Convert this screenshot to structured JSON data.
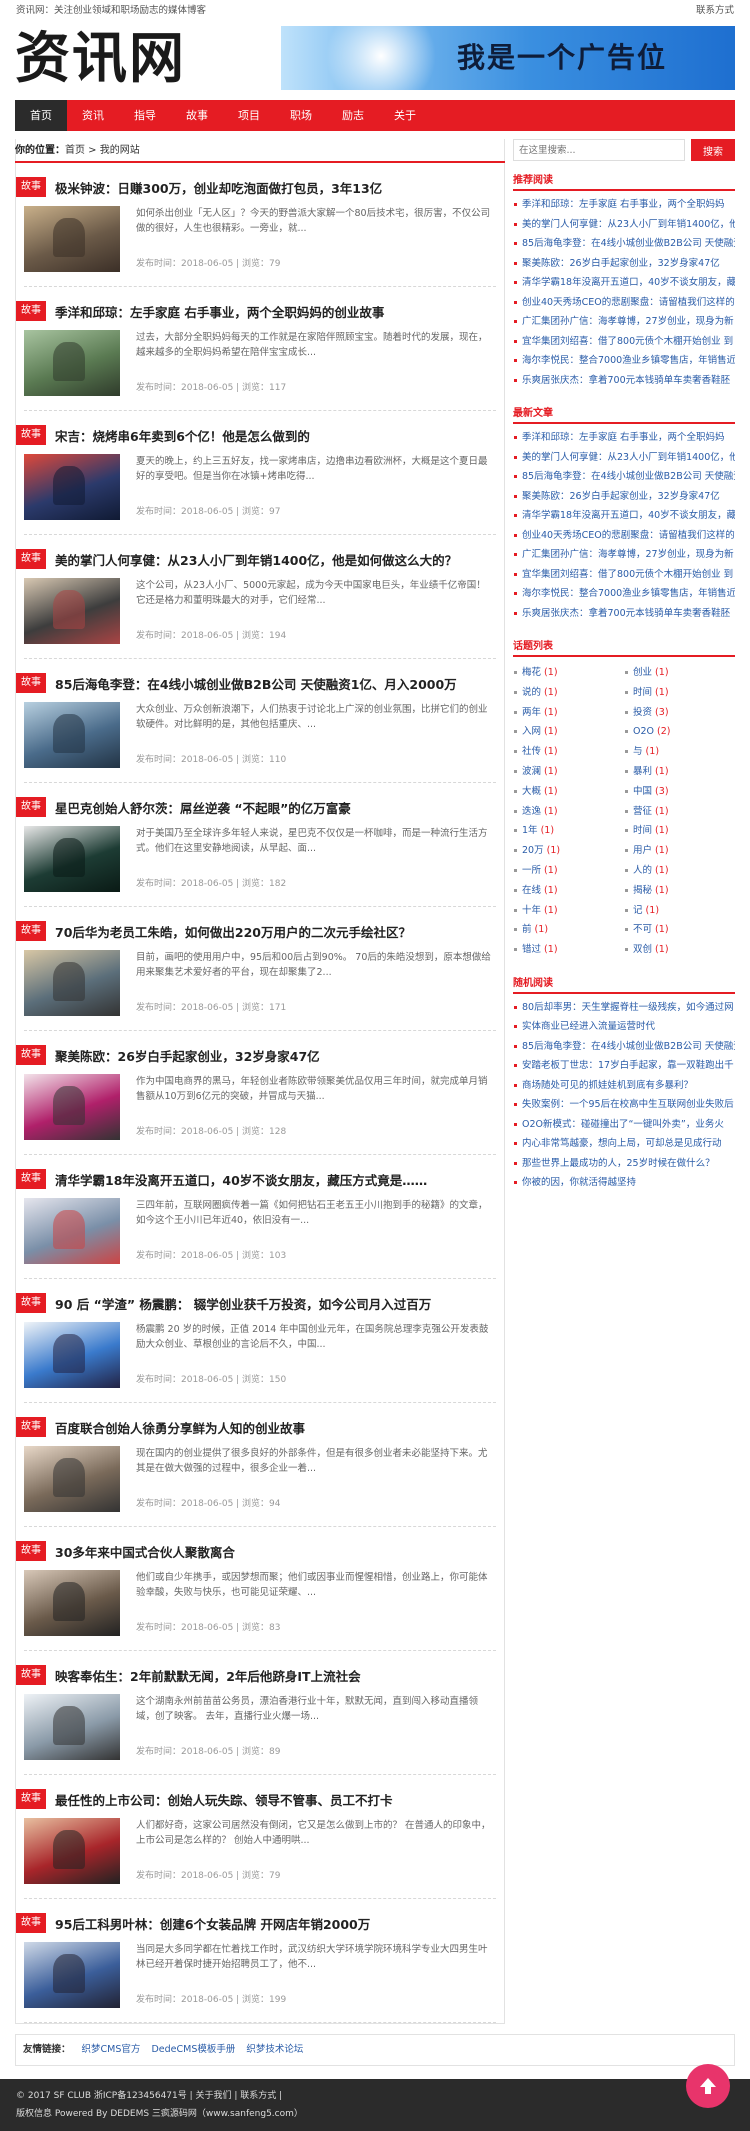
{
  "topbar": {
    "slogan": "资讯网：关注创业领域和职场励志的媒体博客",
    "contact": "联系方式"
  },
  "header": {
    "logo": "资讯网",
    "banner": "我是一个广告位"
  },
  "nav": [
    "首页",
    "资讯",
    "指导",
    "故事",
    "项目",
    "职场",
    "励志",
    "关于"
  ],
  "crumb": {
    "label": "你的位置：",
    "path": "首页 > 我的网站"
  },
  "search": {
    "placeholder": "在这里搜索...",
    "button": "搜索"
  },
  "articles": [
    {
      "tag": "故事",
      "title": "极米钟波：日赚300万，创业却吃泡面做打包员，3年13亿",
      "summary": "如何杀出创业「无人区」？今天的野兽派大家解一个80后技术宅，很厉害，不仅公司做的很好，人生也很精彩。一旁业，就...",
      "meta": "发布时间：2018-06-05 | 浏览：79"
    },
    {
      "tag": "故事",
      "title": "季洋和邱琼：左手家庭 右手事业，两个全职妈妈的创业故事",
      "summary": "过去，大部分全职妈妈每天的工作就是在家陪伴照顾宝宝。随着时代的发展，现在，越来越多的全职妈妈希望在陪伴宝宝成长...",
      "meta": "发布时间：2018-06-05 | 浏览：117"
    },
    {
      "tag": "故事",
      "title": "宋吉：烧烤串6年卖到6个亿！他是怎么做到的",
      "summary": "夏天的晚上，约上三五好友，找一家烤串店，边撸串边看欧洲杯，大概是这个夏日最好的享受吧。但是当你在冰镇+烤串吃得...",
      "meta": "发布时间：2018-06-05 | 浏览：97"
    },
    {
      "tag": "故事",
      "title": "美的掌门人何享健：从23人小厂到年销1400亿，他是如何做这么大的？",
      "summary": "这个公司，从23人小厂、5000元家起，成为今天中国家电巨头，年业绩千亿帝国！ 它还是格力和董明珠最大的对手，它们经常...",
      "meta": "发布时间：2018-06-05 | 浏览：194"
    },
    {
      "tag": "故事",
      "title": "85后海龟李登：在4线小城创业做B2B公司 天使融资1亿、月入2000万",
      "summary": "大众创业、万众创新浪潮下，人们热衷于讨论北上广深的创业氛围，比拼它们的创业软硬件。对比鲜明的是，其他包括重庆、...",
      "meta": "发布时间：2018-06-05 | 浏览：110"
    },
    {
      "tag": "故事",
      "title": "星巴克创始人舒尔茨：屌丝逆袭 “不起眼”的亿万富豪",
      "summary": "对于美国乃至全球许多年轻人来说，星巴克不仅仅是一杯咖啡，而是一种流行生活方式。他们在这里安静地阅读，从早起、面...",
      "meta": "发布时间：2018-06-05 | 浏览：182"
    },
    {
      "tag": "故事",
      "title": "70后华为老员工朱皓，如何做出220万用户的二次元手绘社区？",
      "summary": "目前，画吧的使用用户中，95后和00后占到90%。 70后的朱皓没想到，原本想做给用来聚集艺术爱好者的平台，现在却聚集了2...",
      "meta": "发布时间：2018-06-05 | 浏览：171"
    },
    {
      "tag": "故事",
      "title": "聚美陈欧：26岁白手起家创业，32岁身家47亿",
      "summary": "作为中国电商界的黑马，年轻创业者陈欧带领聚美优品仅用三年时间，就完成单月销售额从10万到6亿元的突破，并冒成与天猫...",
      "meta": "发布时间：2018-06-05 | 浏览：128"
    },
    {
      "tag": "故事",
      "title": "清华学霸18年没离开五道口，40岁不谈女朋友，藏压方式竟是……",
      "summary": "三四年前，互联网圈疯传着一篇《如何把钻石王老五王小川抱到手的秘籍》的文章，如今这个王小川已年近40，依旧没有一...",
      "meta": "发布时间：2018-06-05 | 浏览：103"
    },
    {
      "tag": "故事",
      "title": "90 后 “学渣” 杨震鹏： 辍学创业获千万投资，如今公司月入过百万",
      "summary": "杨震鹏 20 岁的时候，正值 2014 年中国创业元年，在国务院总理李克强公开发表鼓励大众创业、草根创业的言论后不久，中国...",
      "meta": "发布时间：2018-06-05 | 浏览：150"
    },
    {
      "tag": "故事",
      "title": "百度联合创始人徐勇分享鲜为人知的创业故事",
      "summary": "现在国内的创业提供了很多良好的外部条件，但是有很多创业者未必能坚持下来。尤其是在做大做强的过程中，很多企业一着...",
      "meta": "发布时间：2018-06-05 | 浏览：94"
    },
    {
      "tag": "故事",
      "title": "30多年来中国式合伙人聚散离合",
      "summary": "他们或自少年携手，或因梦想而聚；他们或因事业而惺惺相惜，创业路上，你可能体验幸酸，失败与快乐，也可能见证荣耀、...",
      "meta": "发布时间：2018-06-05 | 浏览：83"
    },
    {
      "tag": "故事",
      "title": "映客奉佑生：2年前默默无闻，2年后他跻身IT上流社会",
      "summary": "这个湖南永州前苗苗公务员，漂泊香港行业十年，默默无闻，直到闯入移动直播领域，创了映客。 去年，直播行业火爆一场...",
      "meta": "发布时间：2018-06-05 | 浏览：89"
    },
    {
      "tag": "故事",
      "title": "最任性的上市公司：创始人玩失踪、领导不管事、员工不打卡",
      "summary": "人们都好奇，这家公司居然没有倒闭，它又是怎么做到上市的？ 在普通人的印象中，上市公司是怎么样的？ 创始人中通明哄...",
      "meta": "发布时间：2018-06-05 | 浏览：79"
    },
    {
      "tag": "故事",
      "title": "95后工科男叶林：创建6个女装品牌 开网店年销2000万",
      "summary": "当同是大多同学都在忙着找工作时，武汉纺织大学环境学院环境科学专业大四男生叶林已经开着保时捷开始招聘员工了，他不...",
      "meta": "发布时间：2018-06-05 | 浏览：199"
    }
  ],
  "sidebar": {
    "recommend_title": "推荐阅读",
    "recommend": [
      "季洋和邱琼：左手家庭 右手事业，两个全职妈妈",
      "美的掌门人何享健：从23人小厂到年销1400亿，他",
      "85后海龟李登：在4线小城创业做B2B公司 天使融资",
      "聚美陈欧：26岁白手起家创业，32岁身家47亿",
      "清华学霸18年没离开五道口，40岁不谈女朋友，藏",
      "创业40天秀场CEO的悲剧聚盘：请留植我们这样的",
      "广汇集团孙广信：海孝尊博，27岁创业，现身为新",
      "宜华集团刘绍喜：借了800元债个木棚开始创业 到",
      "海尔李悦民：整合7000渔业乡镇零售店，年销售近",
      "乐爽居张庆杰：拿着700元本钱骑单车卖奢香鞋胚"
    ],
    "latest_title": "最新文章",
    "latest": [
      "季洋和邱琼：左手家庭 右手事业，两个全职妈妈",
      "美的掌门人何享健：从23人小厂到年销1400亿，他",
      "85后海龟李登：在4线小城创业做B2B公司 天使融资",
      "聚美陈欧：26岁白手起家创业，32岁身家47亿",
      "清华学霸18年没离开五道口，40岁不谈女朋友，藏",
      "创业40天秀场CEO的悲剧聚盘：请留植我们这样的",
      "广汇集团孙广信：海孝尊博，27岁创业，现身为新",
      "宜华集团刘绍喜：借了800元债个木棚开始创业 到",
      "海尔李悦民：整合7000渔业乡镇零售店，年销售近",
      "乐爽居张庆杰：拿着700元本钱骑单车卖奢香鞋胚"
    ],
    "tags_title": "话题列表",
    "tags": [
      [
        "梅花",
        "1"
      ],
      [
        "创业",
        "1"
      ],
      [
        "说的",
        "1"
      ],
      [
        "时间",
        "1"
      ],
      [
        "两年",
        "1"
      ],
      [
        "投资",
        "3"
      ],
      [
        "入网",
        "1"
      ],
      [
        "O2O",
        "2"
      ],
      [
        "社传",
        "1"
      ],
      [
        "与",
        "1"
      ],
      [
        "波澜",
        "1"
      ],
      [
        "暴利",
        "1"
      ],
      [
        "大概",
        "1"
      ],
      [
        "中国",
        "3"
      ],
      [
        "迭逸",
        "1"
      ],
      [
        "营征",
        "1"
      ],
      [
        "1年",
        "1"
      ],
      [
        "时间",
        "1"
      ],
      [
        "20万",
        "1"
      ],
      [
        "用户",
        "1"
      ],
      [
        "一所",
        "1"
      ],
      [
        "人的",
        "1"
      ],
      [
        "在线",
        "1"
      ],
      [
        "揭秘",
        "1"
      ],
      [
        "十年",
        "1"
      ],
      [
        "记",
        "1"
      ],
      [
        "前",
        "1"
      ],
      [
        "不可",
        "1"
      ],
      [
        "错过",
        "1"
      ],
      [
        "双创",
        "1"
      ]
    ],
    "random_title": "随机阅读",
    "random": [
      "80后却率男：天生掌握脊柱一级残疾，如今通过网",
      "实体商业已经进入流量运营时代",
      "85后海龟李登：在4线小城创业做B2B公司 天使融资",
      "安踏老板丁世忠：17岁白手起家，靠一双鞋跑出千",
      "商场随处可见的抓娃娃机到底有多暴利？",
      "失败案例：一个95后在校高中生互联网创业失败后",
      "O2O新模式：碰碰撞出了“一键叫外卖”，业务火",
      "内心非常笃越豪，想向上局，可却总是见成行动",
      "那些世界上最成功的人，25岁时候在做什么？",
      "你被的因，你就活得越坚持"
    ]
  },
  "friends": {
    "label": "友情链接：",
    "links": [
      "织梦CMS官方",
      "DedeCMS模板手册",
      "织梦技术论坛"
    ]
  },
  "footer": {
    "line1": "© 2017 SF CLUB 浙ICP备123456471号 | 关于我们 | 联系方式 |",
    "line2": "版权信息 Powered By DEDEMS 三疯源码网（www.sanfeng5.com）"
  },
  "colors": {
    "accent": "#e51c23",
    "dark": "#2b2b2b",
    "link": "#2a5ca8"
  }
}
